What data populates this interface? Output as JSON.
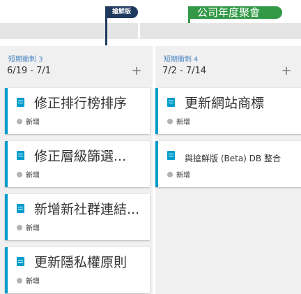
{
  "timeline": {
    "marker_dark_label": "搶鮮版",
    "marker_green_label": "公司年度聚會"
  },
  "columns": [
    {
      "sprint": "短期衝刺 3",
      "dates": "6/19 - 7/1",
      "add_label": "+",
      "cards": [
        {
          "title": "修正排行榜排序",
          "state": "新增"
        },
        {
          "title": "修正層級篩選...",
          "state": "新增"
        },
        {
          "title": "新增新社群連結...",
          "state": "新增"
        },
        {
          "title": "更新隱私權原則",
          "state": "新增"
        }
      ]
    },
    {
      "sprint": "短期衝刺 4",
      "dates": "7/2 - 7/14",
      "add_label": "+",
      "cards": [
        {
          "title": "更新網站商標",
          "state": "新增"
        },
        {
          "title": "與搶鮮版 (Beta) DB 整合",
          "state": "新增"
        }
      ]
    }
  ],
  "colors": {
    "card_accent": "#009ccc",
    "marker_dark": "#1f3a5f",
    "marker_green": "#339947",
    "sprint_label": "#4a86c5"
  }
}
